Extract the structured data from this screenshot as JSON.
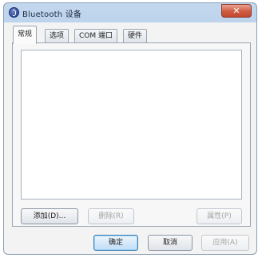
{
  "window": {
    "title": "Bluetooth 设备",
    "close_glyph": "✕"
  },
  "tabs": [
    {
      "label": "常规",
      "active": true
    },
    {
      "label": "选项",
      "active": false
    },
    {
      "label": "COM 端口",
      "active": false
    },
    {
      "label": "硬件",
      "active": false
    }
  ],
  "device_list": {
    "items": []
  },
  "panel_buttons": {
    "add": "添加(D)...",
    "remove": "删除(R)",
    "properties": "属性(P)"
  },
  "dialog_buttons": {
    "ok": "确定",
    "cancel": "取消",
    "apply": "应用(A)"
  },
  "colors": {
    "titlebar": "#bcd3ec",
    "close_button": "#cf5a3f",
    "default_button": "#bfdcf5"
  }
}
